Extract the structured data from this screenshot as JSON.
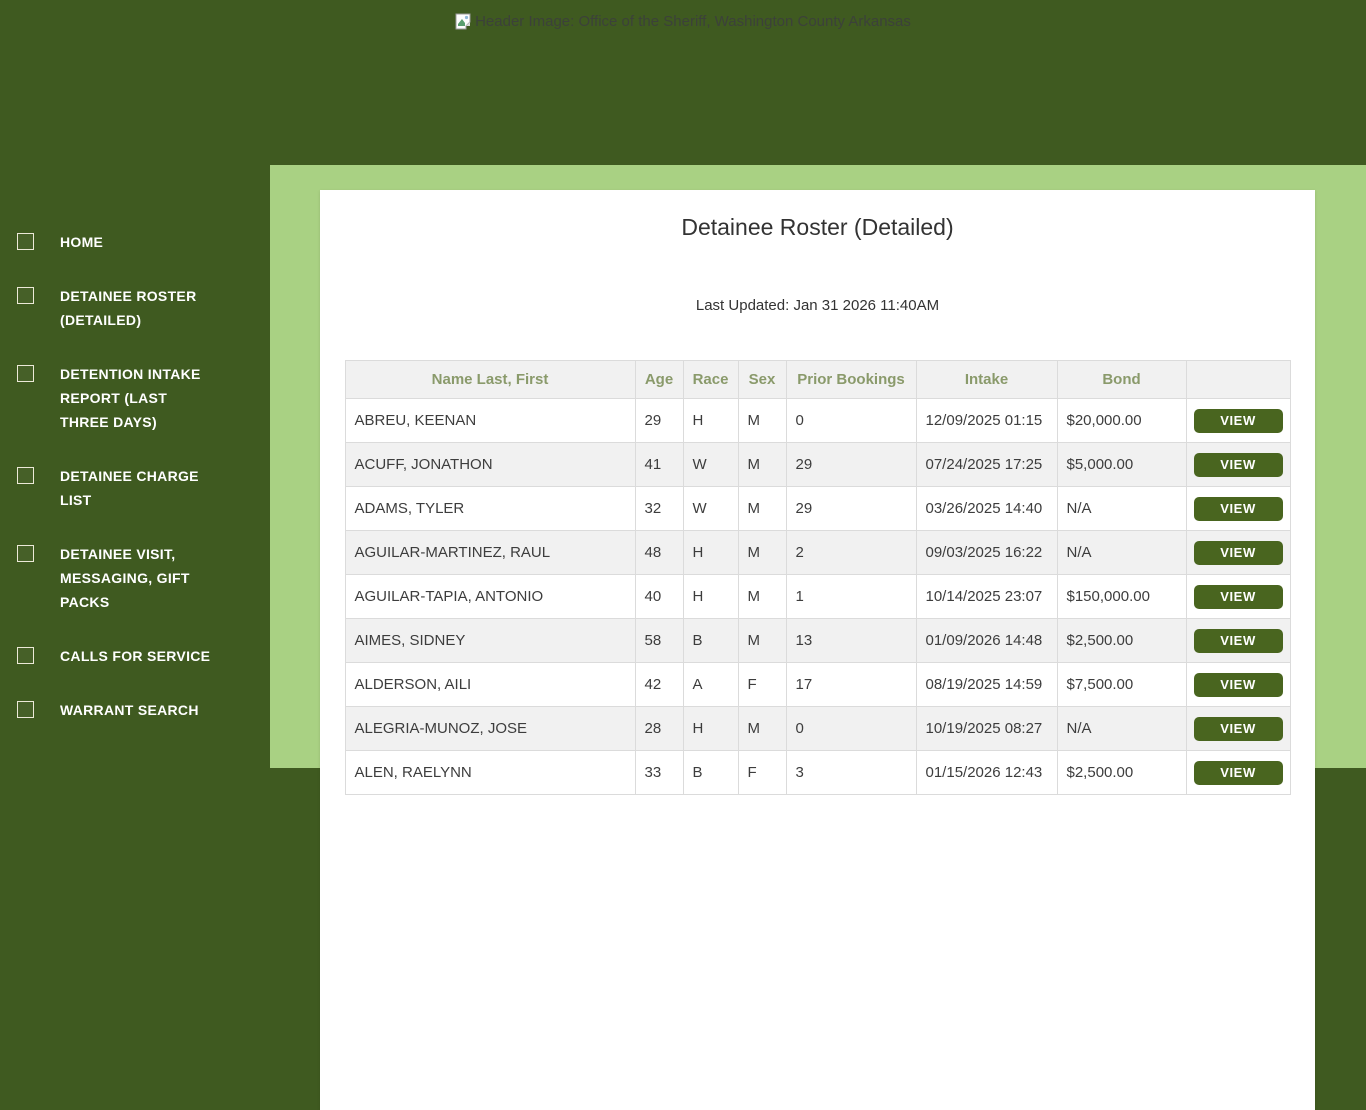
{
  "header": {
    "alt_text": "Header Image: Office of the Sheriff, Washington County Arkansas"
  },
  "sidebar": {
    "items": [
      {
        "label": "HOME"
      },
      {
        "label": "DETAINEE ROSTER (DETAILED)"
      },
      {
        "label": "DETENTION INTAKE REPORT (LAST THREE DAYS)"
      },
      {
        "label": "DETAINEE CHARGE LIST"
      },
      {
        "label": "DETAINEE VISIT, MESSAGING, GIFT PACKS"
      },
      {
        "label": "CALLS FOR SERVICE"
      },
      {
        "label": "WARRANT SEARCH"
      }
    ]
  },
  "main": {
    "title": "Detainee Roster (Detailed)",
    "last_updated": "Last Updated: Jan 31 2026 11:40AM",
    "table": {
      "columns": [
        "Name Last, First",
        "Age",
        "Race",
        "Sex",
        "Prior Bookings",
        "Intake",
        "Bond",
        ""
      ],
      "action_label": "VIEW",
      "rows": [
        {
          "name": "ABREU, KEENAN",
          "age": "29",
          "race": "H",
          "sex": "M",
          "prior_bookings": "0",
          "intake": "12/09/2025 01:15",
          "bond": "$20,000.00"
        },
        {
          "name": "ACUFF, JONATHON",
          "age": "41",
          "race": "W",
          "sex": "M",
          "prior_bookings": "29",
          "intake": "07/24/2025 17:25",
          "bond": "$5,000.00"
        },
        {
          "name": "ADAMS, TYLER",
          "age": "32",
          "race": "W",
          "sex": "M",
          "prior_bookings": "29",
          "intake": "03/26/2025 14:40",
          "bond": "N/A"
        },
        {
          "name": "AGUILAR-MARTINEZ, RAUL",
          "age": "48",
          "race": "H",
          "sex": "M",
          "prior_bookings": "2",
          "intake": "09/03/2025 16:22",
          "bond": "N/A"
        },
        {
          "name": "AGUILAR-TAPIA, ANTONIO",
          "age": "40",
          "race": "H",
          "sex": "M",
          "prior_bookings": "1",
          "intake": "10/14/2025 23:07",
          "bond": "$150,000.00"
        },
        {
          "name": "AIMES, SIDNEY",
          "age": "58",
          "race": "B",
          "sex": "M",
          "prior_bookings": "13",
          "intake": "01/09/2026 14:48",
          "bond": "$2,500.00"
        },
        {
          "name": "ALDERSON, AILI",
          "age": "42",
          "race": "A",
          "sex": "F",
          "prior_bookings": "17",
          "intake": "08/19/2025 14:59",
          "bond": "$7,500.00"
        },
        {
          "name": "ALEGRIA-MUNOZ, JOSE",
          "age": "28",
          "race": "H",
          "sex": "M",
          "prior_bookings": "0",
          "intake": "10/19/2025 08:27",
          "bond": "N/A"
        },
        {
          "name": "ALEN, RAELYNN",
          "age": "33",
          "race": "B",
          "sex": "F",
          "prior_bookings": "3",
          "intake": "01/15/2026 12:43",
          "bond": "$2,500.00"
        }
      ]
    }
  },
  "colors": {
    "sidebar_green": "#3f5a20",
    "content_green": "#a9d183",
    "button_green": "#49651f",
    "table_header_text": "#8a9a6b",
    "stripe_gray": "#f1f1f1"
  }
}
